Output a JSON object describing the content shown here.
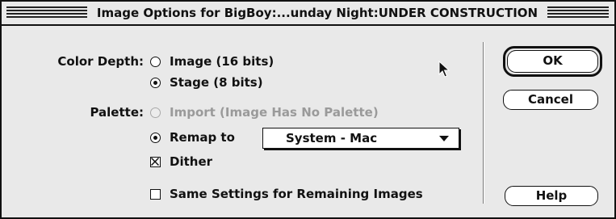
{
  "dialog": {
    "title": "Image Options for BigBoy:...unday Night:UNDER CONSTRUCTION"
  },
  "color_depth": {
    "label": "Color Depth:",
    "options": [
      {
        "label": "Image (16 bits)",
        "selected": false
      },
      {
        "label": "Stage (8 bits)",
        "selected": true
      }
    ]
  },
  "palette": {
    "label": "Palette:",
    "import_option": {
      "label": "Import (Image Has No Palette)",
      "enabled": false,
      "selected": false
    },
    "remap_option": {
      "label": "Remap to",
      "selected": true
    },
    "remap_select": {
      "value": "System - Mac"
    }
  },
  "dither": {
    "label": "Dither",
    "checked": true
  },
  "same_settings": {
    "label": "Same Settings for Remaining Images",
    "checked": false
  },
  "buttons": {
    "ok": "OK",
    "cancel": "Cancel",
    "help": "Help"
  },
  "icons": {
    "cursor": "arrow-cursor-icon",
    "select_arrow": "chevron-down-icon"
  },
  "colors": {
    "background": "#e9e9e9",
    "text": "#111111",
    "disabled_text": "#9a9a9a"
  }
}
